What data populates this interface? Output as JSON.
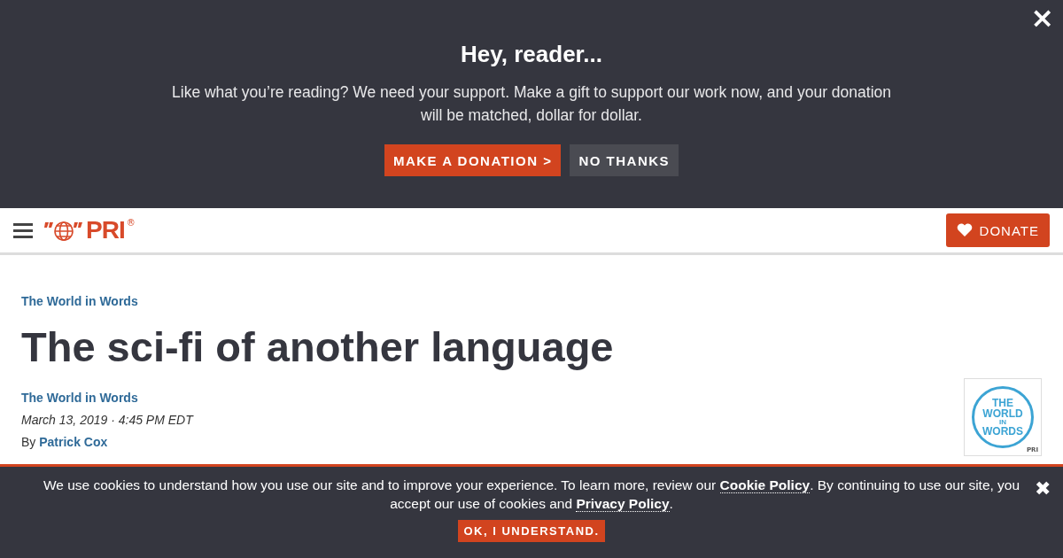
{
  "donation_banner": {
    "close": "×",
    "title": "Hey, reader...",
    "message": "Like what you’re reading? We need your support. Make a gift to support our work now, and your donation will be matched, dollar for dollar.",
    "buttons": [
      {
        "label": "MAKE A DONATION >",
        "kind": "primary"
      },
      {
        "label": "NO THANKS",
        "kind": "secondary"
      }
    ]
  },
  "header": {
    "logo": {
      "text": "PRI",
      "mark": "®"
    },
    "donate_button": "DONATE"
  },
  "article": {
    "category": "The World in Words",
    "title": "The sci-fi of another language",
    "program": "The World in Words",
    "date": "March 13, 2019 · 4:45 PM EDT",
    "byline_prefix": "By",
    "author": "Patrick Cox",
    "program_logo": {
      "lines": [
        "THE",
        "WORLD",
        "IN",
        "WORDS"
      ],
      "badge": "PRI"
    }
  },
  "cookie_banner": {
    "parts": [
      {
        "text": "We use cookies to understand how you use our site and to improve your experience. To learn more, review our ",
        "kind": "text"
      },
      {
        "text": "Cookie Policy",
        "kind": "link"
      },
      {
        "text": ". By continuing to use our site, you accept our use of cookies and ",
        "kind": "text"
      },
      {
        "text": "Privacy Policy",
        "kind": "link"
      },
      {
        "text": ".",
        "kind": "text"
      }
    ],
    "button": "OK, I UNDERSTAND.",
    "close": "✖"
  }
}
